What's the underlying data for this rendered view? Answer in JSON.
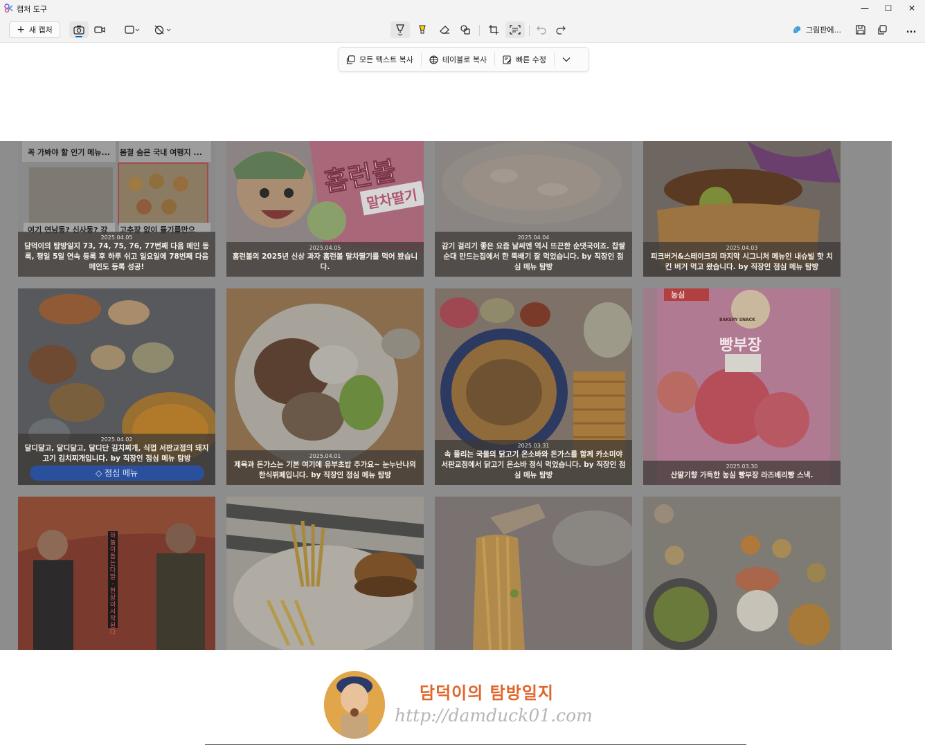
{
  "window": {
    "title": "캡처 도구",
    "minimize": "—",
    "maximize": "☐",
    "close": "✕"
  },
  "toolbar": {
    "new_capture": "새 캡처",
    "paint_label": "그림판에...",
    "more": "..."
  },
  "text_actions": {
    "copy_all_text": "모든 텍스트 복사",
    "copy_as_table": "테이블로 복사",
    "quick_redact": "빠른 수정"
  },
  "cards": [
    {
      "date": "2025.04.05",
      "text": "담덕이의 탐방일지 73, 74, 75, 76, 77번째 다음 메인 등록, 평일 5일 연속 등록 후 하루 쉬고 일요일에 78번째 다음 메인도 등록 성공!",
      "top_left": "꼭 가봐야 할 인기 메뉴...",
      "top_right": "봄철 숨은 국내 여행지 ...",
      "bottom_left": "여기 연남동? 신사동? 강",
      "bottom_right": "고추장 없이 들기름만으"
    },
    {
      "date": "2025.04.05",
      "text": "홈런볼의 2025년 신상 과자 홈런볼 말차딸기를 먹어 봤습니다.",
      "pkg_main": "홈런볼",
      "pkg_sub": "말차딸기"
    },
    {
      "date": "2025.04.04",
      "text": "감기 걸리기 좋은 요즘 날씨엔 역시 뜨끈한 순댓국이죠. 찹쌀순대 만드는집에서 한 뚝배기 잘 먹었습니다. by 직장인 점심 메뉴 탐방"
    },
    {
      "date": "2025.04.03",
      "text": "피크버거&스테이크의 마지막 시그니처 메뉴인 내슈빌 핫 치킨 버거 먹고 왔습니다. by 직장인 점심 메뉴 탐방"
    },
    {
      "date": "2025.04.02",
      "text": "달디달고, 달디달고, 달디단 김치찌개, 식껍 서판교점의 돼지고기 김치찌개입니다. by 직장인 점심 메뉴 탐방",
      "pill": "점심 메뉴"
    },
    {
      "date": "2025.04.01",
      "text": "제육과 돈가스는 기본 여기에 유부초밥 추가요~ 눈누난나의 한식뷔페입니다. by 직장인 점심 메뉴 탐방"
    },
    {
      "date": "2025.03.31",
      "text": "속 풀리는 국물의 닭고기 온소바와 돈가스를 함께 카소미야 서판교점에서 닭고기 온소바 정식 먹었습니다. by 직장인 점심 메뉴 탐방"
    },
    {
      "date": "2025.03.30",
      "text": "산딸기향 가득한 농심 빵부장 라즈베리빵 스낵.",
      "brand": "농심",
      "pkg_main": "빵부장",
      "badge": "BAKERY SNACK"
    },
    {
      "vertical_text": "하늘이 돕는다 말 · 천상이 시작된다"
    },
    {},
    {},
    {}
  ],
  "footer": {
    "title": "담덕이의 탐방일지",
    "url": "http://damduck01.com"
  },
  "colors": {
    "accent": "#0067c0",
    "footer_title": "#e0652b",
    "overlay": "#8d8d8d"
  }
}
